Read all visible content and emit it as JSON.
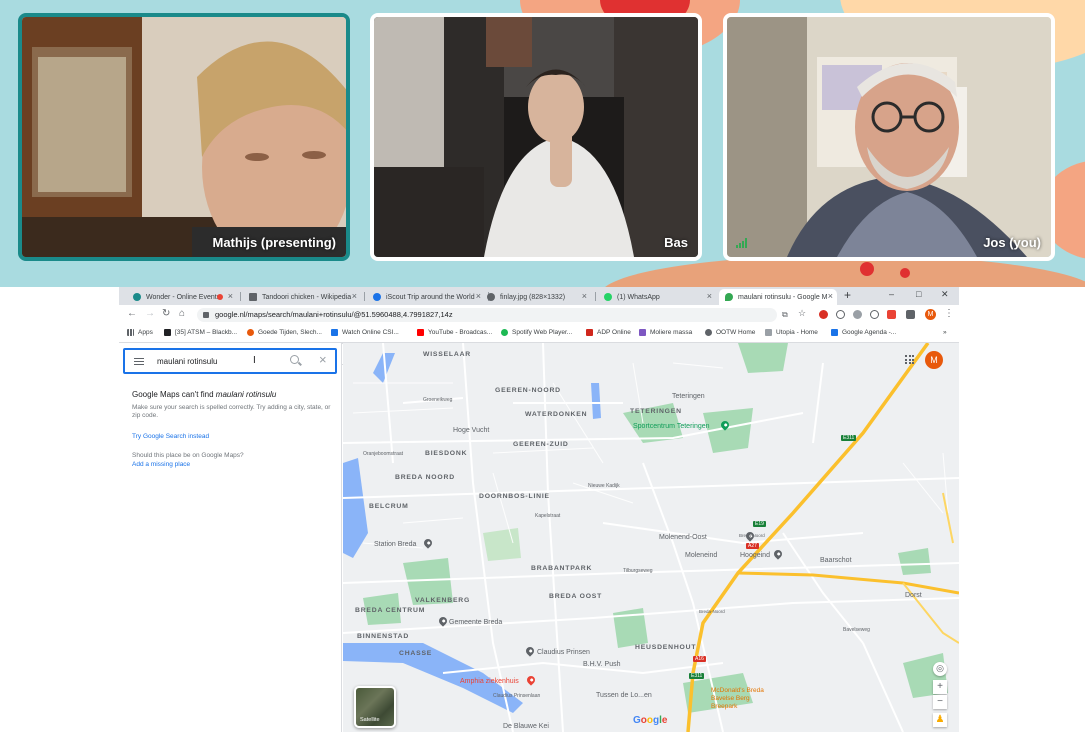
{
  "call": {
    "participants": [
      {
        "name": "Mathijs (presenting)"
      },
      {
        "name": "Bas"
      },
      {
        "name": "Jos (you)"
      }
    ]
  },
  "browser": {
    "tabs": [
      {
        "label": "Wonder - Online Events",
        "icon_color": "#1a8a8a"
      },
      {
        "label": "Tandoori chicken - Wikipedia",
        "icon_color": "#5f6368"
      },
      {
        "label": "iScout Trip around the World",
        "icon_color": "#1a73e8"
      },
      {
        "label": "finlay.jpg (828×1332)",
        "icon_color": "#5f6368"
      },
      {
        "label": "(1) WhatsApp",
        "icon_color": "#25d366"
      },
      {
        "label": "maulani rotinsulu - Google M",
        "icon_color": "#34a853"
      }
    ],
    "new_tab": "+",
    "window_controls": {
      "minimize": "–",
      "maximize": "□",
      "close": "✕"
    },
    "url": "google.nl/maps/search/maulani+rotinsulu/@51.5960488,4.7991827,14z",
    "profile_initial": "M",
    "bookmarks": [
      {
        "label": "Apps",
        "icon": "apps-icon",
        "color": "#5f6368"
      },
      {
        "label": "[35] ATSM – Blackb...",
        "icon": "bookmark-icon",
        "color": "#202124"
      },
      {
        "label": "Goede Tijden, Slech...",
        "icon": "bookmark-icon",
        "color": "#e8590c"
      },
      {
        "label": "Watch Online CSI...",
        "icon": "bookmark-icon",
        "color": "#1a73e8"
      },
      {
        "label": "YouTube - Broadcas...",
        "icon": "youtube-icon",
        "color": "#ff0000"
      },
      {
        "label": "Spotify Web Player...",
        "icon": "spotify-icon",
        "color": "#1db954"
      },
      {
        "label": "ADP Online",
        "icon": "bookmark-icon",
        "color": "#d0271d"
      },
      {
        "label": "Moliere massa",
        "icon": "bookmark-icon",
        "color": "#7e57c2"
      },
      {
        "label": "OOTW Home",
        "icon": "globe-icon",
        "color": "#5f6368"
      },
      {
        "label": "Utopia - Home",
        "icon": "bookmark-icon",
        "color": "#9aa0a6"
      },
      {
        "label": "Google Agenda -...",
        "icon": "calendar-icon",
        "color": "#1a73e8"
      }
    ],
    "bookmarks_more": "»"
  },
  "maps": {
    "search_value": "maulani rotinsulu",
    "noresult_prefix": "Google Maps can't find ",
    "noresult_query": "maulani rotinsulu",
    "hint": "Make sure your search is spelled correctly. Try adding a city, state, or zip code.",
    "try_search": "Try Google Search instead",
    "should_text": "Should this place be on Google Maps?",
    "add_place": "Add a missing place",
    "avatar_initial": "M",
    "satellite_label": "Satellite",
    "zoom_in": "+",
    "zoom_out": "−",
    "districts": [
      "WISSELAAR",
      "GEEREN-NOORD",
      "WATERDONKEN",
      "TETERINGEN",
      "GEEREN-ZUID",
      "BIESDONK",
      "BREDA NOORD",
      "DOORNBOS-LINIE",
      "BELCRUM",
      "BRABANTPARK",
      "VALKENBERG",
      "BREDA OOST",
      "BREDA CENTRUM",
      "BINNENSTAD",
      "CHASSE",
      "HEUSDENHOUT"
    ],
    "places": [
      "Teteringen",
      "Sportcentrum Teteringen",
      "Hoge Vucht",
      "Station Breda",
      "Molenend-Oost",
      "Moleneind",
      "Hoogeind",
      "Baarschot",
      "Dorst",
      "Gemeente Breda",
      "Claudius Prinsen",
      "B.H.V. Push",
      "Amphia ziekenhuis",
      "Tussen de Lo...en",
      "McDonald's Breda Bavelse Berg Breepark",
      "Breda-Noord",
      "Breda-Noord",
      "De Blauwe Kei"
    ],
    "roads": [
      "Groeneikweg",
      "Oranjeboomstraat",
      "Nieuwe Kadijk",
      "Kapelstraat",
      "Tilburgseweg",
      "Claudius Prinsenlaan",
      "Bavelseweg"
    ],
    "shields": [
      "E311",
      "A27",
      "A16",
      "E311",
      "E19"
    ]
  },
  "colors": {
    "call_bg": "#a9dbe0",
    "active_border": "#1a8a8a",
    "accent_blue": "#1a73e8",
    "map_bg": "#eef0f2",
    "park": "#a8dab5",
    "water": "#8ab4f8",
    "highway": "#fbc02d"
  }
}
